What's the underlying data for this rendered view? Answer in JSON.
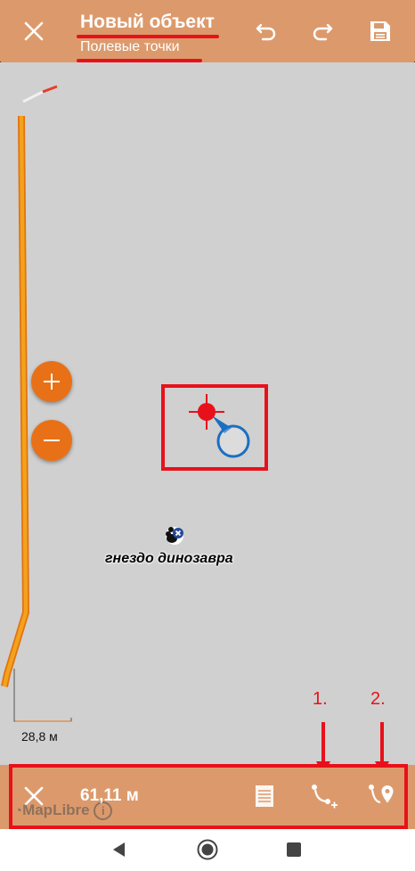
{
  "header": {
    "title": "Новый объект",
    "subtitle": "Полевые точки",
    "close_icon": "close-icon",
    "undo_icon": "undo-icon",
    "redo_icon": "redo-icon",
    "save_icon": "save-icon"
  },
  "map": {
    "scale_label": "28,8 м",
    "poi_label": "гнездо динозавра",
    "zoom_in_icon": "plus-icon",
    "zoom_out_icon": "minus-icon"
  },
  "annotations": {
    "label_1": "1.",
    "label_2": "2."
  },
  "bottom_bar": {
    "distance": "61,11 м",
    "attribution": "MapLibre",
    "close_icon": "close-icon",
    "list_icon": "list-icon",
    "add_vertex_icon": "add-vertex-icon",
    "add_gps_point_icon": "add-gps-point-icon"
  },
  "colors": {
    "header_bg": "#dc9a6c",
    "accent": "#e87118",
    "annotation": "#e8111b",
    "location_blue": "#1b6fc2",
    "map_bg": "#d0d0d0"
  }
}
